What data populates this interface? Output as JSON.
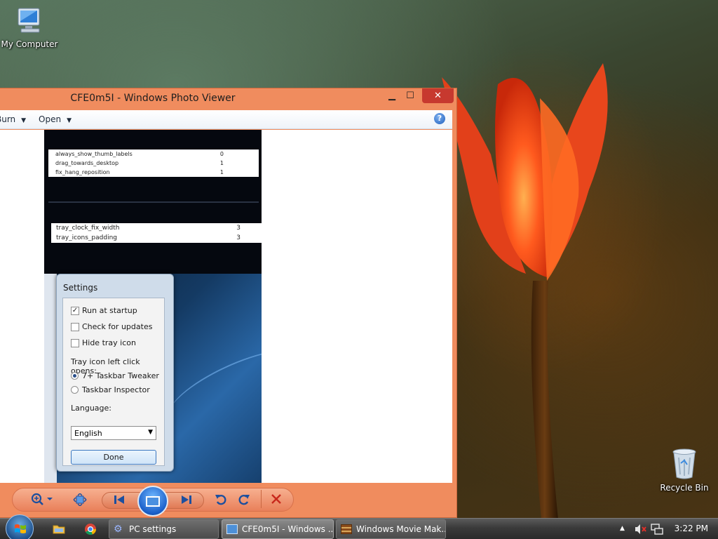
{
  "desktop": {
    "icons": [
      {
        "label": "My Computer",
        "icon": "computer-icon"
      },
      {
        "label": "Recycle Bin",
        "icon": "recycle-bin-icon"
      }
    ]
  },
  "viewer": {
    "title": "CFE0m5I - Windows Photo Viewer",
    "caption_buttons": {
      "minimize": "▁",
      "maximize": "☐",
      "close": "✕"
    },
    "menu": {
      "burn": "Burn",
      "open": "Open",
      "dropdown_arrow": "▼",
      "help": "?"
    },
    "photo": {
      "table1": [
        {
          "name": "always_show_thumb_labels",
          "value": "0"
        },
        {
          "name": "drag_towards_desktop",
          "value": "1"
        },
        {
          "name": "fix_hang_reposition",
          "value": "1"
        }
      ],
      "table2": [
        {
          "name": "tray_clock_fix_width",
          "value": "3"
        },
        {
          "name": "tray_icons_padding",
          "value": "3"
        }
      ],
      "settings": {
        "title": "Settings",
        "run_at_startup": "Run at startup",
        "run_at_startup_checked": true,
        "check_for_updates": "Check for updates",
        "hide_tray_icon": "Hide tray icon",
        "tray_click_label": "Tray icon left click opens:",
        "option_tweaker": "7+ Taskbar Tweaker",
        "option_inspector": "Taskbar Inspector",
        "selected_option": "7+ Taskbar Tweaker",
        "language_label": "Language:",
        "language_value": "English",
        "done": "Done"
      }
    },
    "controls": [
      "zoom",
      "actual-size",
      "previous",
      "slideshow",
      "next",
      "rotate-counterclockwise",
      "rotate-clockwise",
      "delete"
    ]
  },
  "taskbar": {
    "pinned": [
      "explorer",
      "chrome"
    ],
    "tasks": [
      {
        "label": "PC settings",
        "icon": "gear-icon"
      },
      {
        "label": "CFE0m5I - Windows ...",
        "icon": "photo-viewer-icon",
        "active": true
      },
      {
        "label": "Windows Movie Mak...",
        "icon": "film-icon"
      }
    ],
    "tray": {
      "show_hidden": "▲",
      "clock": "3:22 PM"
    }
  },
  "colors": {
    "window_frame": "#f08c5e",
    "close_button": "#c7392f",
    "accent_blue": "#1d4f9e",
    "taskbar": "#3a3a3a"
  }
}
